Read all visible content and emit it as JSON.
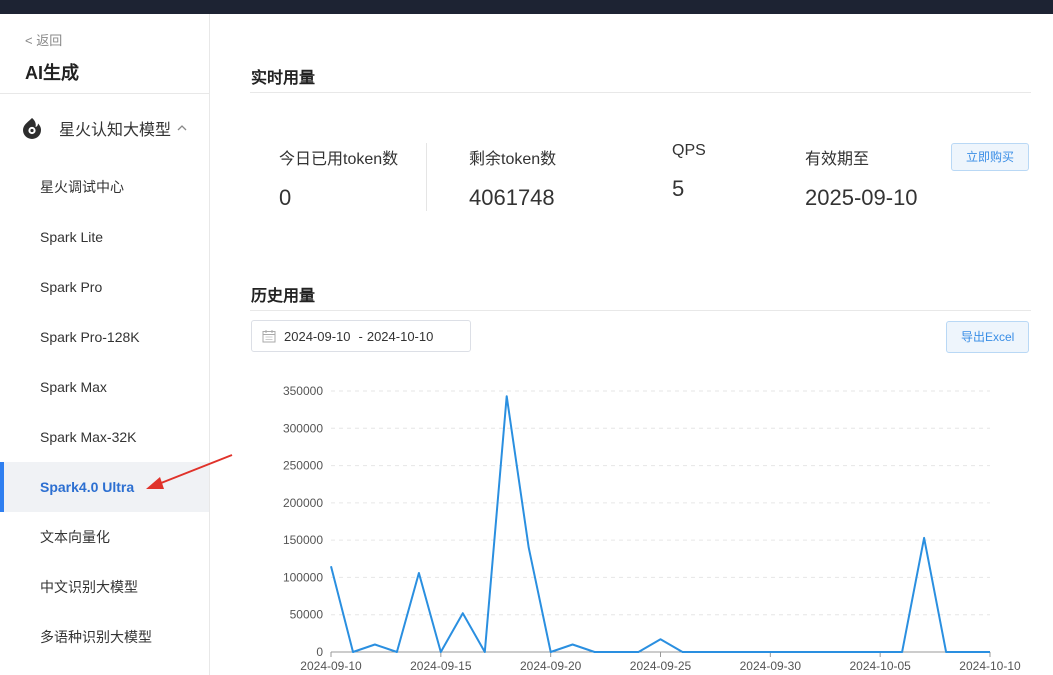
{
  "sidebar": {
    "back": "< 返回",
    "app_title": "AI生成",
    "group": {
      "label": "星火认知大模型",
      "icon": "spark-logo-icon"
    },
    "items": [
      {
        "label": "星火调试中心",
        "active": false
      },
      {
        "label": "Spark Lite",
        "active": false
      },
      {
        "label": "Spark Pro",
        "active": false
      },
      {
        "label": "Spark Pro-128K",
        "active": false
      },
      {
        "label": "Spark Max",
        "active": false
      },
      {
        "label": "Spark Max-32K",
        "active": false
      },
      {
        "label": "Spark4.0 Ultra",
        "active": true
      },
      {
        "label": "文本向量化",
        "active": false
      },
      {
        "label": "中文识别大模型",
        "active": false
      },
      {
        "label": "多语种识别大模型",
        "active": false
      }
    ]
  },
  "realtime": {
    "title": "实时用量",
    "stats": [
      {
        "label": "今日已用token数",
        "value": "0"
      },
      {
        "label": "剩余token数",
        "value": "4061748"
      },
      {
        "label": "QPS",
        "value": "5"
      },
      {
        "label": "有效期至",
        "value": "2025-09-10"
      }
    ],
    "buy_button": "立即购买"
  },
  "history": {
    "title": "历史用量",
    "date_start": "2024-09-10",
    "date_sep": "-",
    "date_end": "2024-10-10",
    "export_button": "导出Excel"
  },
  "colors": {
    "accent": "#3a8ee6",
    "line": "#2a8fe0",
    "arrow": "#e0322a",
    "active_bar": "#2f7ff0"
  },
  "chart_data": {
    "type": "line",
    "title": "",
    "xlabel": "",
    "ylabel": "",
    "x": [
      "2024-09-10",
      "2024-09-11",
      "2024-09-12",
      "2024-09-13",
      "2024-09-14",
      "2024-09-15",
      "2024-09-16",
      "2024-09-17",
      "2024-09-18",
      "2024-09-19",
      "2024-09-20",
      "2024-09-21",
      "2024-09-22",
      "2024-09-23",
      "2024-09-24",
      "2024-09-25",
      "2024-09-26",
      "2024-09-27",
      "2024-09-28",
      "2024-09-29",
      "2024-09-30",
      "2024-10-01",
      "2024-10-02",
      "2024-10-03",
      "2024-10-04",
      "2024-10-05",
      "2024-10-06",
      "2024-10-07",
      "2024-10-08",
      "2024-10-09",
      "2024-10-10"
    ],
    "series": [
      {
        "values": [
          115000,
          0,
          10000,
          0,
          106000,
          0,
          52000,
          0,
          343000,
          140000,
          0,
          10000,
          0,
          0,
          0,
          17000,
          0,
          0,
          0,
          0,
          0,
          0,
          0,
          0,
          0,
          0,
          0,
          153000,
          0,
          0,
          0
        ]
      }
    ],
    "x_ticks": [
      "2024-09-10",
      "2024-09-15",
      "2024-09-20",
      "2024-09-25",
      "2024-09-30",
      "2024-10-05",
      "2024-10-10"
    ],
    "y_ticks": [
      0,
      50000,
      100000,
      150000,
      200000,
      250000,
      300000,
      350000
    ],
    "ylim": [
      0,
      350000
    ],
    "grid": true,
    "legend": "none"
  }
}
